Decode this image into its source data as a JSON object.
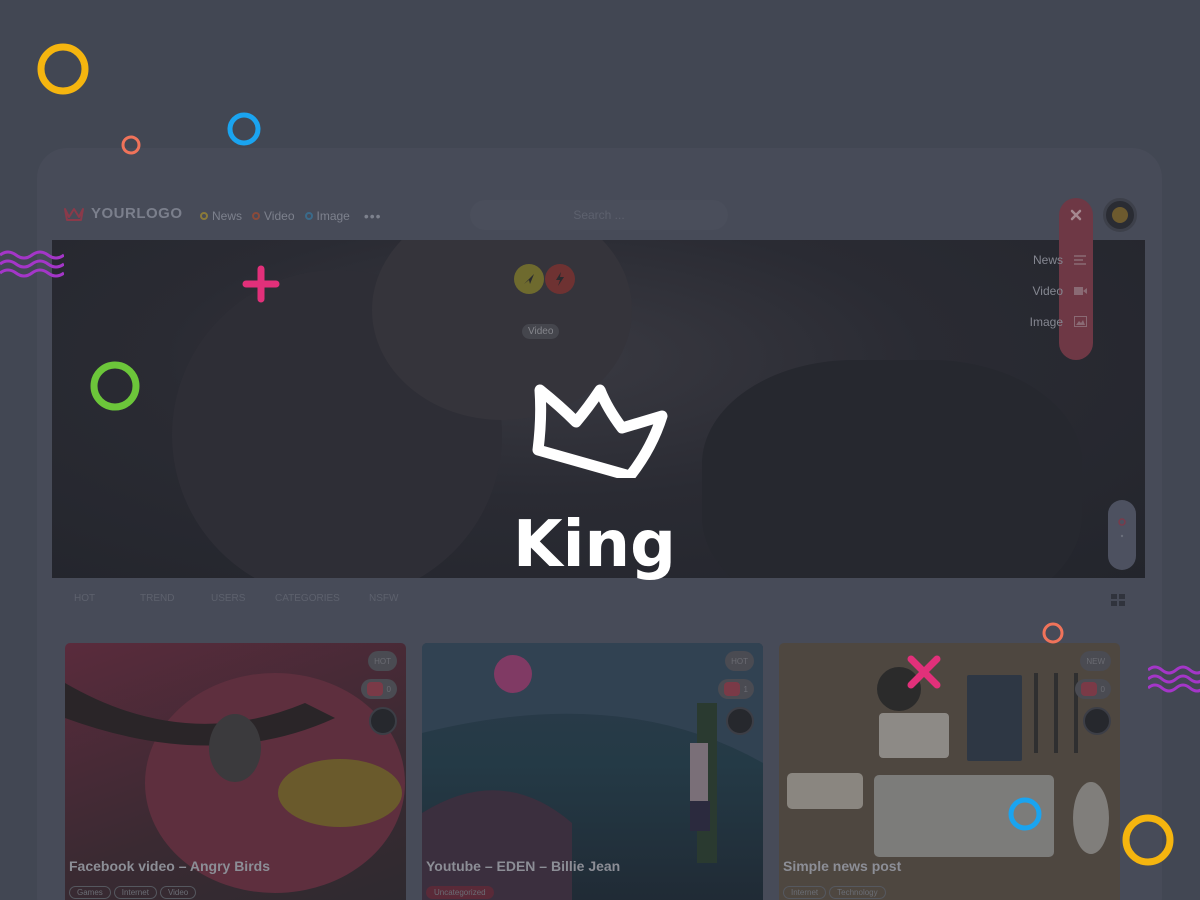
{
  "brand": {
    "logo_text": "YOURLOGO",
    "name": "King"
  },
  "nav": {
    "items": [
      {
        "label": "News",
        "color": "#8a7a3a"
      },
      {
        "label": "Video",
        "color": "#8a4a3a"
      },
      {
        "label": "Image",
        "color": "#3a6a8a"
      }
    ],
    "more_label": "•••"
  },
  "search": {
    "placeholder": "Search ..."
  },
  "hero": {
    "label": "Video"
  },
  "side_menu": {
    "items": [
      {
        "label": "News",
        "icon": "list-icon"
      },
      {
        "label": "Video",
        "icon": "video-camera-icon"
      },
      {
        "label": "Image",
        "icon": "image-icon"
      }
    ]
  },
  "tabs": [
    "HOT",
    "TREND",
    "USERS",
    "CATEGORIES",
    "NSFW"
  ],
  "cards": [
    {
      "title": "Facebook video – Angry Birds",
      "tags": [
        "Games",
        "Internet",
        "Video"
      ],
      "badge_top": "HOT",
      "badge_count": "0"
    },
    {
      "title": "Youtube – EDEN – Billie Jean",
      "tags": [
        "Uncategorized"
      ],
      "badge_top": "HOT",
      "badge_count": "1"
    },
    {
      "title": "Simple news post",
      "tags": [
        "Internet",
        "Technology"
      ],
      "badge_top": "NEW",
      "badge_count": "0"
    }
  ],
  "colors": {
    "background": "#424753",
    "accent_yellow": "#f5b50f",
    "accent_blue": "#1aa4f0",
    "accent_orange": "#f0735a",
    "accent_pink": "#e2307a",
    "accent_green": "#6cc63a",
    "accent_purple": "#a436c8"
  }
}
